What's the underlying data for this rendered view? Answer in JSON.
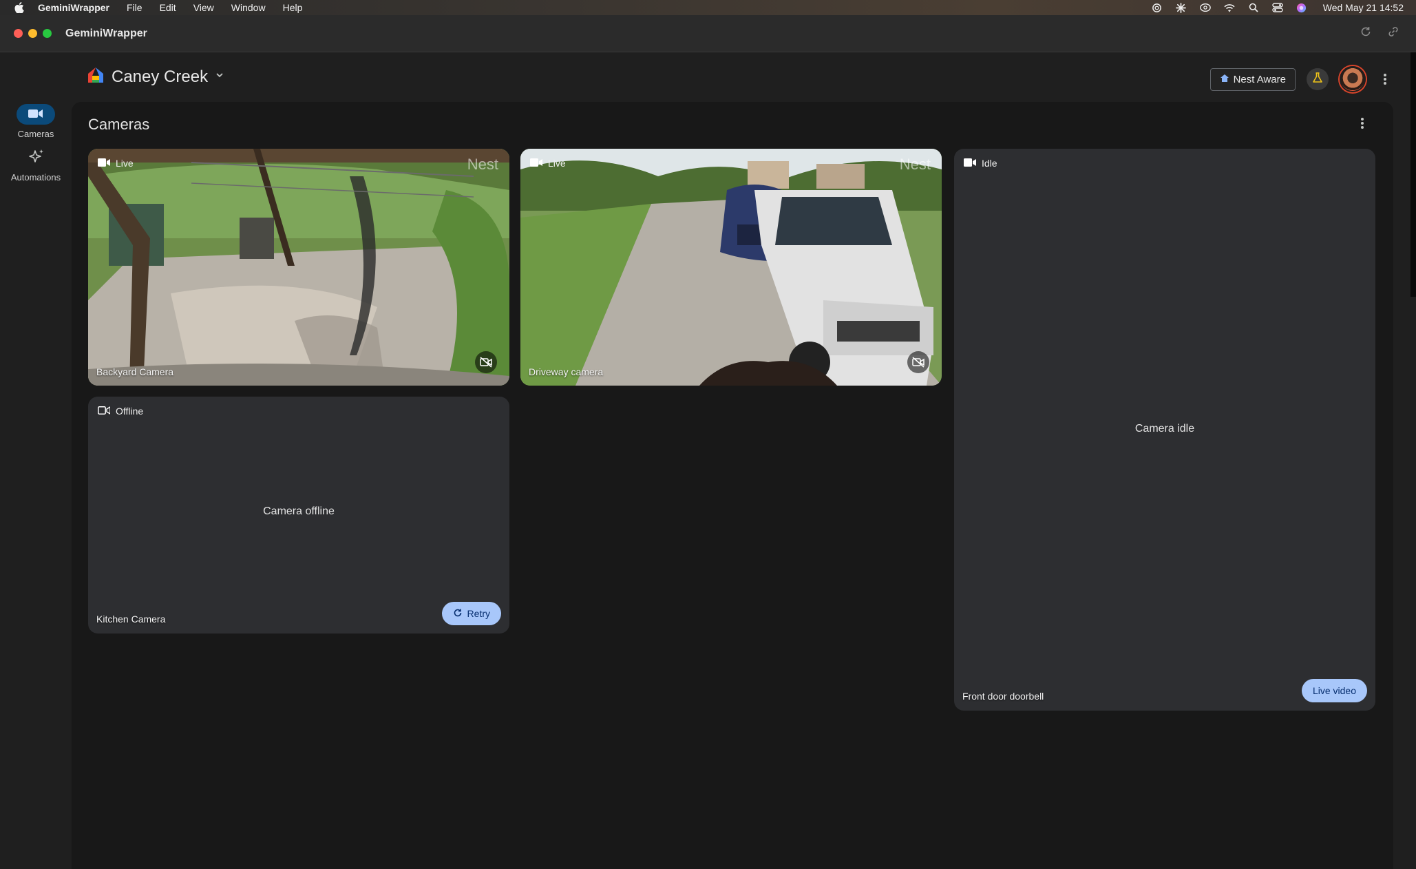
{
  "menubar": {
    "app_name": "GeminiWrapper",
    "menus": [
      "File",
      "Edit",
      "View",
      "Window",
      "Help"
    ],
    "clock": "Wed May 21  14:52"
  },
  "window": {
    "title": "GeminiWrapper"
  },
  "nav": {
    "items": [
      {
        "label": "Cameras",
        "icon": "videocam-icon",
        "active": true
      },
      {
        "label": "Automations",
        "icon": "sparkle-icon",
        "active": false
      }
    ]
  },
  "header": {
    "home_name": "Caney Creek",
    "nest_aware_label": "Nest Aware"
  },
  "panel": {
    "title": "Cameras"
  },
  "cameras": [
    {
      "name": "Backyard Camera",
      "status": "Live",
      "watermark": "Nest"
    },
    {
      "name": "Driveway camera",
      "status": "Live",
      "watermark": "Nest"
    },
    {
      "name": "Front door doorbell",
      "status": "Idle",
      "message": "Camera idle",
      "action_label": "Live video"
    },
    {
      "name": "Kitchen Camera",
      "status": "Offline",
      "message": "Camera offline",
      "action_label": "Retry"
    }
  ],
  "colors": {
    "accent_button": "#a8c7fa",
    "active_nav": "#0b4a7a",
    "card_bg": "#2d2e31"
  }
}
